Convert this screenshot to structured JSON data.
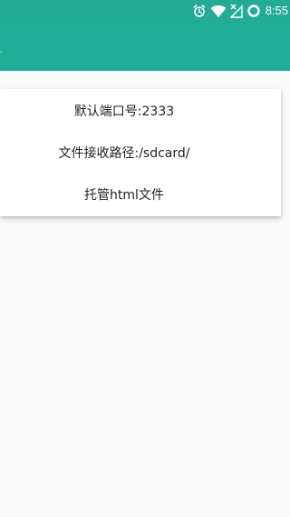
{
  "status_bar": {
    "time": "8:55",
    "icons": [
      "alarm-icon",
      "wifi-icon",
      "signal-off-icon",
      "loading-circle-icon"
    ],
    "color": "#24ab96"
  },
  "app_bar": {
    "color": "#21ad97"
  },
  "card": {
    "items": [
      {
        "label": "默认端口号:2333"
      },
      {
        "label": "文件接收路径:/sdcard/"
      },
      {
        "label": "托管html文件"
      }
    ]
  },
  "colors": {
    "background": "#fafafa",
    "card": "#ffffff",
    "text": "#222222"
  }
}
